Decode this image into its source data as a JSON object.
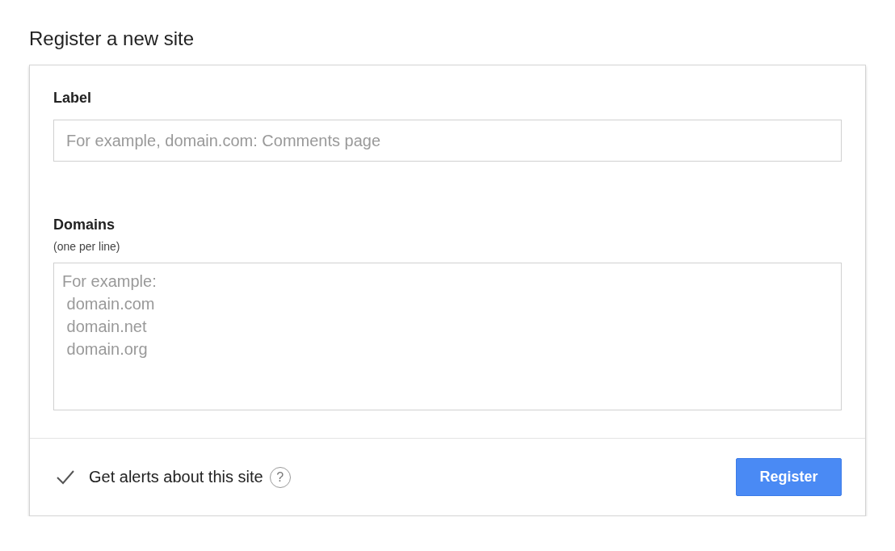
{
  "title": "Register a new site",
  "label_field": {
    "label": "Label",
    "placeholder": "For example, domain.com: Comments page"
  },
  "domains_field": {
    "label": "Domains",
    "hint": "(one per line)",
    "placeholder": "For example:\n domain.com\n domain.net\n domain.org"
  },
  "alerts": {
    "label": "Get alerts about this site",
    "checked": true,
    "help": "?"
  },
  "register_button": "Register"
}
